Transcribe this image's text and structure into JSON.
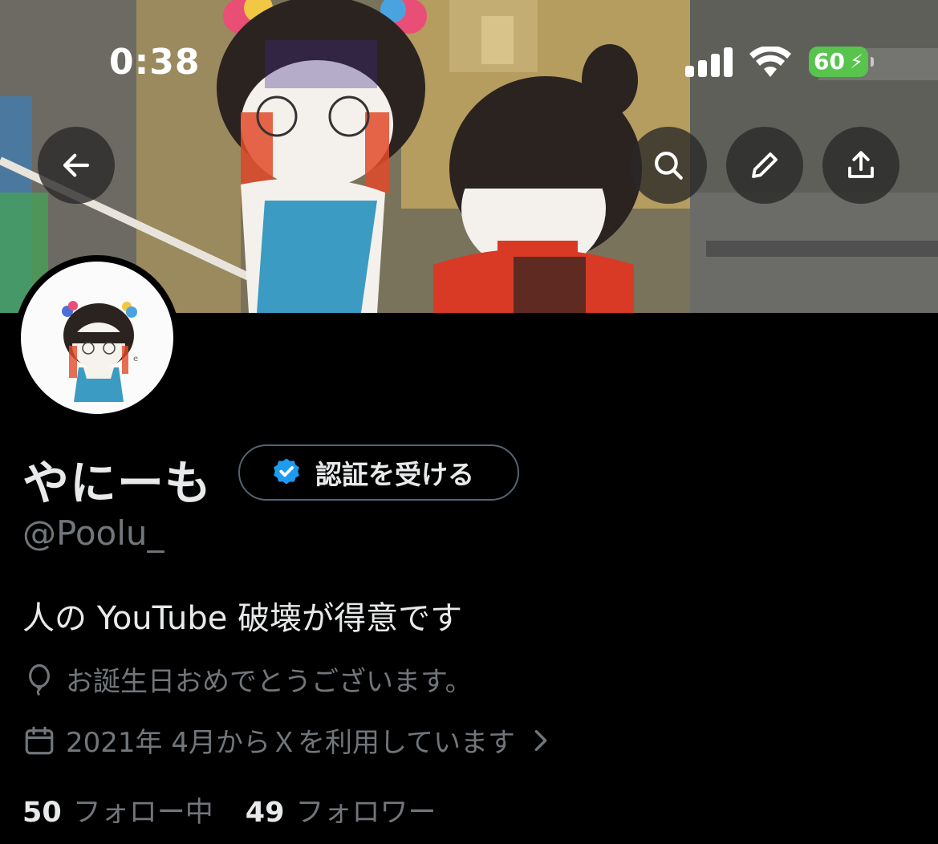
{
  "status_bar": {
    "time": "0:38",
    "battery": "60",
    "battery_color": "#58c44e"
  },
  "header": {
    "back_icon": "arrow-left-icon",
    "search_icon": "search-icon",
    "edit_icon": "pencil-icon",
    "share_icon": "share-icon"
  },
  "profile": {
    "display_name": "やにーも",
    "verify_label": "認証を受ける",
    "verify_badge_color": "#1d9bf0",
    "handle": "@Poolu_",
    "bio": "人の YouTube 破壊が得意です",
    "birthday": "お誕生日おめでとうございます。",
    "joined": "2021年 4月からＸを利用しています"
  },
  "stats": {
    "following_count": "50",
    "following_label": "フォロー中",
    "followers_count": "49",
    "followers_label": "フォロワー"
  }
}
